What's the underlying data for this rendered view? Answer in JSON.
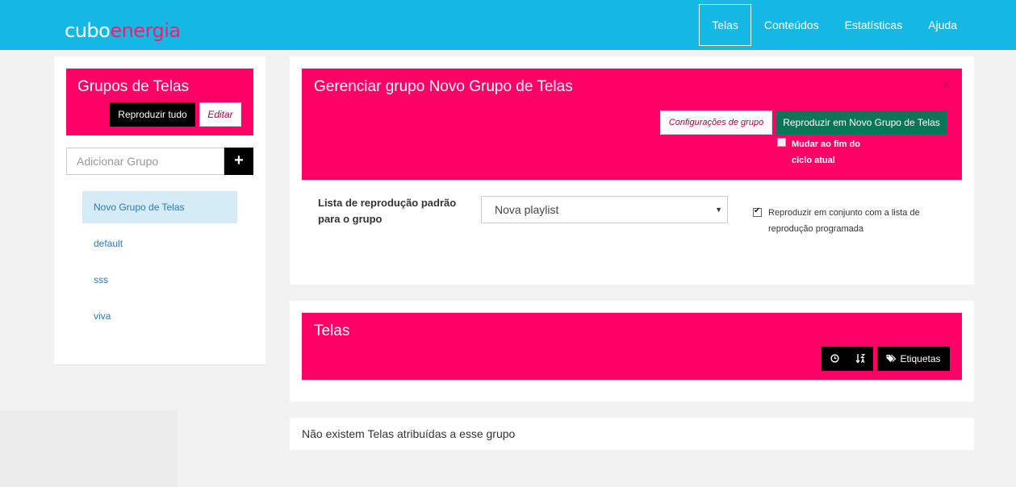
{
  "brand": {
    "part1": "cubo",
    "part2": "energia"
  },
  "nav": [
    {
      "label": "Telas",
      "active": true
    },
    {
      "label": "Conteúdos"
    },
    {
      "label": "Estatísticas"
    },
    {
      "label": "Ajuda"
    }
  ],
  "groups_panel": {
    "title": "Grupos de Telas",
    "play_all_label": "Reproduzir tudo",
    "edit_label": "Editar",
    "add_placeholder": "Adicionar Grupo",
    "add_icon": "+",
    "items": [
      {
        "label": "Novo Grupo de Telas",
        "active": true
      },
      {
        "label": "default"
      },
      {
        "label": "sss"
      },
      {
        "label": "viva"
      }
    ]
  },
  "manage_panel": {
    "title": "Gerenciar grupo Novo Grupo de Telas",
    "close_icon": "×",
    "config_label": "Configurações de grupo",
    "play_label": "Reproduzir em Novo Grupo de Telas",
    "cycle_label": "Mudar ao fim do ciclo atual",
    "playlist_label": "Lista de reprodução padrão para o grupo",
    "playlist_value": "Nova playlist",
    "together_label": "Reproduzir em conjunto com a lista de reprodução programada",
    "together_checked": true,
    "cycle_checked": false
  },
  "screens_panel": {
    "title": "Telas",
    "tags_label": "Etiquetas",
    "empty_message": "Não existem Telas atribuídas a esse grupo"
  },
  "colors": {
    "topbar": "#14b9e3",
    "accent_pink": "#ff0066",
    "play_green": "#0b7557"
  }
}
